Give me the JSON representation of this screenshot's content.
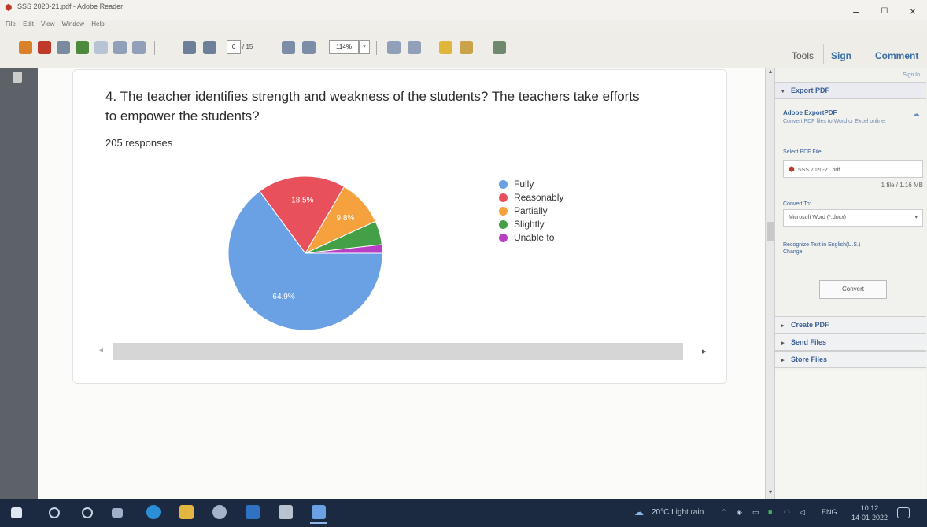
{
  "window": {
    "title": "SSS 2020-21.pdf - Adobe Reader",
    "minimize_glyph": "–",
    "maximize_glyph": "◻",
    "close_glyph": "×"
  },
  "menu": [
    "File",
    "Edit",
    "View",
    "Window",
    "Help"
  ],
  "toolbar": {
    "page_current": "6",
    "page_total": "/ 15",
    "zoom": "114%",
    "zoom_arrow": "▾"
  },
  "pane_tabs": {
    "tools": "Tools",
    "sign": "Sign",
    "comment": "Comment"
  },
  "document": {
    "question": "4. The teacher identifies strength and weakness of the students? The teachers take efforts to empower the students?",
    "responses": "205 responses"
  },
  "chart_data": {
    "type": "pie",
    "slices": [
      {
        "label": "Fully",
        "value": 64.9,
        "color": "#6aa0e4",
        "display": "64.9%"
      },
      {
        "label": "Reasonably",
        "value": 18.5,
        "color": "#e8505b",
        "display": "18.5%"
      },
      {
        "label": "Partially",
        "value": 9.8,
        "color": "#f5a13d",
        "display": "9.8%"
      },
      {
        "label": "Slightly",
        "value": 5.0,
        "color": "#43a047",
        "display": ""
      },
      {
        "label": "Unable to",
        "value": 1.8,
        "color": "#b83fc4",
        "display": ""
      }
    ],
    "legend_position": "right"
  },
  "scroll": {
    "left_glyph": "◂",
    "right_glyph": "▸",
    "up_glyph": "▴",
    "down_glyph": "▾"
  },
  "right_pane": {
    "sign_in": "Sign In",
    "export_header": "Export PDF",
    "export_arrow": "▾",
    "service_title": "Adobe ExportPDF",
    "service_desc": "Convert PDF files to Word or Excel online.",
    "select_label": "Select PDF File:",
    "file_name": "SSS 2020-21.pdf",
    "file_size": "1 file / 1.16 MB",
    "convert_to_label": "Convert To:",
    "convert_to_value": "Microsoft Word (*.docx)",
    "recognize_text": "Recognize Text in English(U.S.)",
    "change_link": "Change",
    "convert_button": "Convert",
    "collapsed_arrow": "▸",
    "sections": [
      "Create PDF",
      "Send Files",
      "Store Files"
    ]
  },
  "taskbar": {
    "weather": "20°C  Light rain",
    "language": "ENG",
    "time": "10:12",
    "date": "14-01-2022"
  },
  "colors": {
    "accent": "#3a5f95",
    "taskbar": "#1b2a40",
    "left_panel": "#5d6168"
  }
}
